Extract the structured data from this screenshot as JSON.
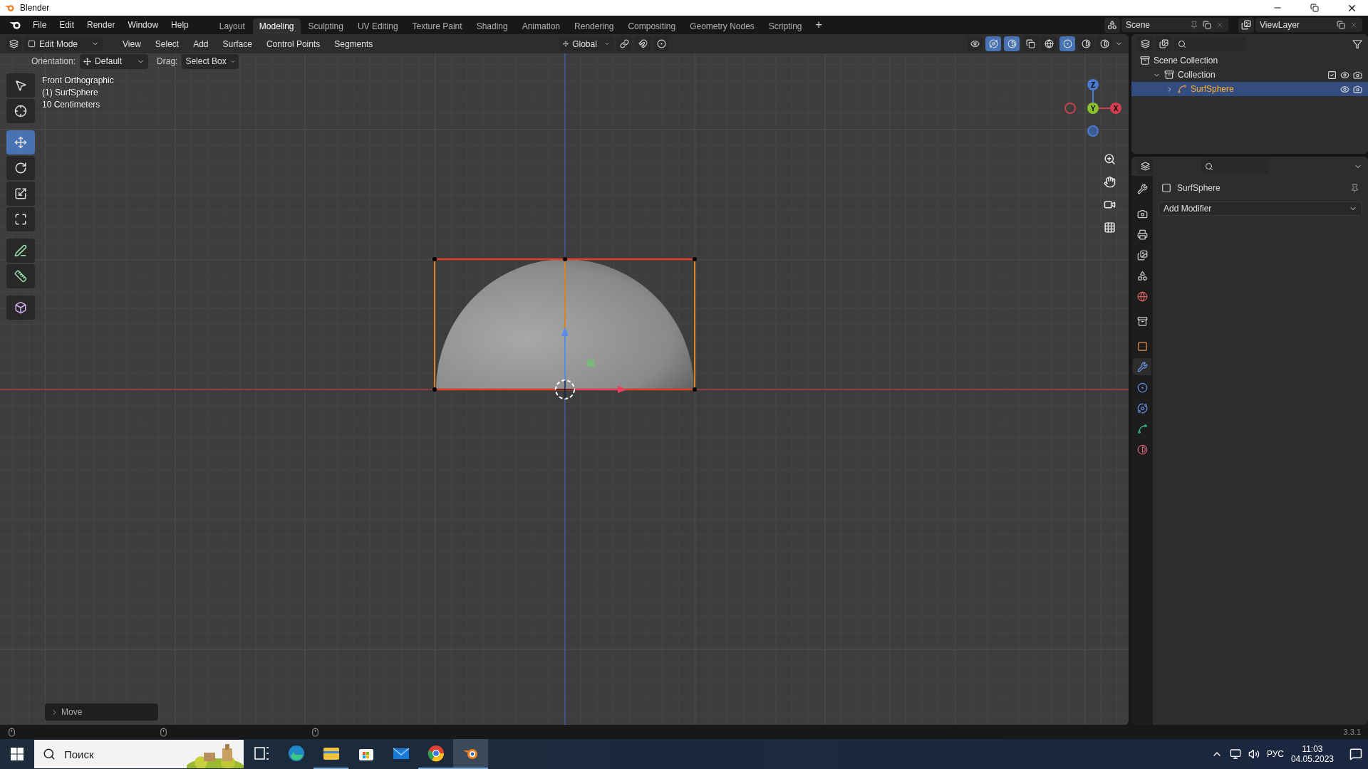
{
  "window": {
    "title": "Blender"
  },
  "menu": [
    "File",
    "Edit",
    "Render",
    "Window",
    "Help"
  ],
  "workspaces": [
    {
      "label": "Layout",
      "selected": false
    },
    {
      "label": "Modeling",
      "selected": true
    },
    {
      "label": "Sculpting",
      "selected": false
    },
    {
      "label": "UV Editing",
      "selected": false
    },
    {
      "label": "Texture Paint",
      "selected": false
    },
    {
      "label": "Shading",
      "selected": false
    },
    {
      "label": "Animation",
      "selected": false
    },
    {
      "label": "Rendering",
      "selected": false
    },
    {
      "label": "Compositing",
      "selected": false
    },
    {
      "label": "Geometry Nodes",
      "selected": false
    },
    {
      "label": "Scripting",
      "selected": false
    }
  ],
  "add_workspace": "+",
  "scene": "Scene",
  "view_layer": "ViewLayer",
  "viewport": {
    "mode": "Edit Mode",
    "menus": [
      "View",
      "Select",
      "Add",
      "Surface",
      "Control Points",
      "Segments"
    ],
    "orientation_global": "Global",
    "tool_settings": {
      "orientation_label": "Orientation:",
      "orientation": "Default",
      "drag_label": "Drag:",
      "drag": "Select Box"
    },
    "tools": [
      {
        "selected": false
      },
      {
        "selected": false
      },
      {
        "selected": true
      },
      {
        "selected": false
      },
      {
        "selected": false
      },
      {
        "selected": false
      },
      {
        "selected": false
      },
      {
        "selected": false
      },
      {
        "selected": false
      }
    ],
    "overlay_text": [
      "Front Orthographic",
      "(1) SurfSphere",
      "10 Centimeters"
    ],
    "gizmo": {
      "z": "Z",
      "y": "Y",
      "x": "X"
    },
    "shading": [
      {
        "selected": false
      },
      {
        "selected": true
      },
      {
        "selected": false
      },
      {
        "selected": false
      }
    ],
    "last_operator": "Move"
  },
  "outliner": {
    "items": [
      {
        "label": "Scene Collection",
        "children": [
          {
            "label": "Collection",
            "expanded": true,
            "children": [
              {
                "label": "SurfSphere",
                "selected": true,
                "expanded": false
              }
            ]
          }
        ]
      }
    ]
  },
  "properties": {
    "object": "SurfSphere",
    "add_modifier": "Add Modifier",
    "tabs": [
      {
        "selected": false
      },
      {
        "selected": false
      },
      {
        "selected": false
      },
      {
        "selected": false
      },
      {
        "selected": false
      },
      {
        "selected": false
      },
      {
        "selected": false
      },
      {
        "selected": false
      },
      {
        "selected": true
      },
      {
        "selected": false
      },
      {
        "selected": false
      },
      {
        "selected": false
      },
      {
        "selected": false
      }
    ]
  },
  "status_bar": {
    "version": "3.3.1"
  },
  "taskbar": {
    "search_placeholder": "Поиск",
    "language": "РУС",
    "time": "11:03",
    "date": "04.05.2023",
    "apps": [
      {
        "selected": false,
        "running": false
      },
      {
        "selected": false,
        "running": false
      },
      {
        "selected": false,
        "running": true
      },
      {
        "selected": false,
        "running": false
      },
      {
        "selected": false,
        "running": false
      },
      {
        "selected": false,
        "running": true
      },
      {
        "selected": true,
        "running": true
      }
    ]
  }
}
